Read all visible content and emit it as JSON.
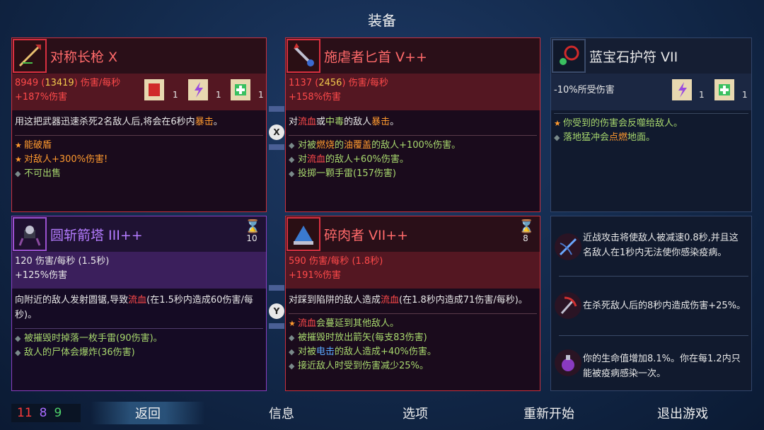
{
  "title": "装备",
  "main_weapon": {
    "name": "对称长枪  X",
    "dps": "8949",
    "dps_crit": "13419",
    "dps_unit": "伤害/每秒",
    "bonus": "+187%伤害",
    "scroll_counts": [
      "1",
      "1",
      "1"
    ],
    "desc": "用这把武器迅速杀死2名敌人后,将会在6秒内",
    "desc_hl": "暴击",
    "desc_end": "。",
    "affixes": [
      "能破盾",
      "对敌人+300%伤害!",
      "不可出售"
    ]
  },
  "secondary_weapon": {
    "name": "施虐者匕首  V++",
    "dps": "1137",
    "dps_crit": "2456",
    "dps_unit": "伤害/每秒",
    "bonus": "+158%伤害",
    "desc_pre": "对",
    "desc_bleed": "流血",
    "desc_or": "或",
    "desc_poison": "中毒",
    "desc_mid": "的敌人",
    "desc_crit": "暴击",
    "desc_end": "。",
    "a1_pre": "对被",
    "a1_burn": "燃烧",
    "a1_mid": "的",
    "a1_oil": "油覆盖",
    "a1_end": "的敌人+100%伤害。",
    "a2_pre": "对",
    "a2_bleed": "流血",
    "a2_end": "的敌人+60%伤害。",
    "a3": "投掷一颗手雷(157伤害)"
  },
  "amulet": {
    "name": "蓝宝石护符  VII",
    "stat": "-10%所受伤害",
    "scroll_counts": [
      "1",
      "1"
    ],
    "a1": "你受到的伤害会反噬给敌人。",
    "a2_pre": "落地猛冲会",
    "a2_burn": "点燃",
    "a2_end": "地面。"
  },
  "skill1": {
    "name": "圆斩箭塔  III++",
    "cooldown": "10",
    "dps": "120 伤害/每秒 (1.5秒)",
    "bonus": "+125%伤害",
    "desc_pre": "向附近的敌人发射圆锯,导致",
    "desc_bleed": "流血",
    "desc_end": "(在1.5秒内造成60伤害/每秒)。",
    "affixes": [
      "被摧毁时掉落一枚手雷(90伤害)。",
      "敌人的尸体会爆炸(36伤害)"
    ]
  },
  "skill2": {
    "name": "碎肉者  VII++",
    "cooldown": "8",
    "dps": "590 伤害/每秒 (1.8秒)",
    "bonus": "+191%伤害",
    "desc_pre": "对踩到陷阱的敌人造成",
    "desc_bleed": "流血",
    "desc_end": "(在1.8秒内造成71伤害/每秒)。",
    "a1_bleed": "流血",
    "a1_end": "会蔓延到其他敌人。",
    "a2": "被摧毁时放出箭矢(每支83伤害)",
    "a3_pre": "对被",
    "a3_elec": "电击",
    "a3_end": "的敌人造成+40%伤害。",
    "a4": "接近敌人时受到伤害减少25%。"
  },
  "mutations": [
    {
      "text": "近战攻击将使敌人被减速0.8秒,并且这名敌人在1秒内无法使你感染疫病。"
    },
    {
      "text": "在杀死敌人后的8秒内造成伤害+25%。"
    },
    {
      "text": "你的生命值增加8.1%。你在每1.2内只能被疫病感染一次。"
    }
  ],
  "swap_buttons": [
    "X",
    "Y"
  ],
  "scroll_counts": {
    "brutality": "11",
    "tactics": "8",
    "survival": "9"
  },
  "menu": {
    "back": "返回",
    "info": "信息",
    "options": "选项",
    "restart": "重新开始",
    "quit": "退出游戏"
  },
  "colors": {
    "brutality": "#ff3b3b",
    "tactics": "#a96bff",
    "survival": "#4ed06a"
  }
}
